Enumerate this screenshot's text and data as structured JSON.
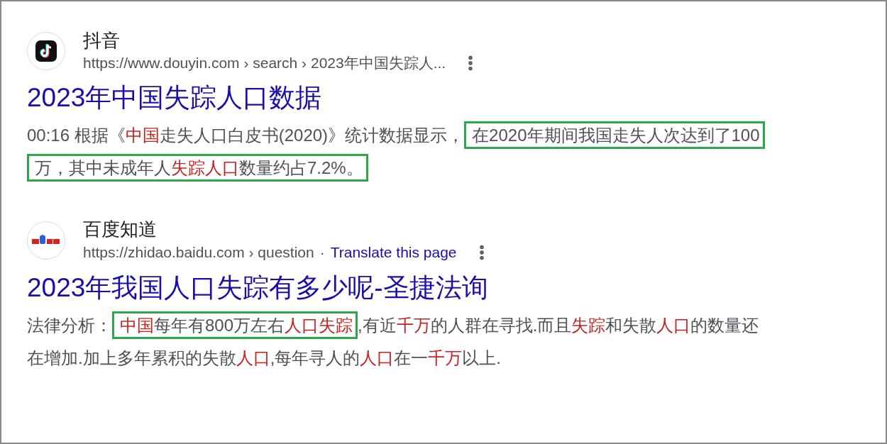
{
  "results": [
    {
      "logo": {
        "kind": "music-note"
      },
      "site": "抖音",
      "url": "https://www.douyin.com › search › 2023年中国失踪人...",
      "title": "2023年中国失踪人口数据",
      "snippet": [
        [
          {
            "boxed": false,
            "segments": [
              {
                "text": "00:16 根据《",
                "red": false
              },
              {
                "text": "中国",
                "red": true
              },
              {
                "text": "走失人口白皮书(2020)》统计数据显示，",
                "red": false
              }
            ]
          },
          {
            "boxed": true,
            "segments": [
              {
                "text": "在2020年期间我国走失人次达到了100",
                "red": false
              }
            ]
          }
        ],
        [
          {
            "boxed": true,
            "segments": [
              {
                "text": "万，其中未成年人",
                "red": false
              },
              {
                "text": "失踪人口",
                "red": true
              },
              {
                "text": "数量约占7.2%。",
                "red": false
              }
            ]
          }
        ]
      ]
    },
    {
      "logo": {
        "kind": "paw-grid"
      },
      "site": "百度知道",
      "url": "https://zhidao.baidu.com › question",
      "separator": "·",
      "translate": "Translate this page",
      "title": "2023年我国人口失踪有多少呢-圣捷法询",
      "snippet": [
        [
          {
            "boxed": false,
            "segments": [
              {
                "text": "法律分析：",
                "red": false
              }
            ]
          },
          {
            "boxed": true,
            "segments": [
              {
                "text": "中国",
                "red": true
              },
              {
                "text": "每年有800万左右",
                "red": false
              },
              {
                "text": "人口失踪",
                "red": true
              }
            ]
          },
          {
            "boxed": false,
            "segments": [
              {
                "text": ",有近",
                "red": false
              },
              {
                "text": "千万",
                "red": true
              },
              {
                "text": "的人群在寻找.而且",
                "red": false
              },
              {
                "text": "失踪",
                "red": true
              },
              {
                "text": "和失散",
                "red": false
              },
              {
                "text": "人口",
                "red": true
              },
              {
                "text": "的数量还",
                "red": false
              }
            ]
          }
        ],
        [
          {
            "boxed": false,
            "segments": [
              {
                "text": "在增加.加上多年累积的失散",
                "red": false
              },
              {
                "text": "人口",
                "red": true
              },
              {
                "text": ",每年寻人的",
                "red": false
              },
              {
                "text": "人口",
                "red": true
              },
              {
                "text": "在一",
                "red": false
              },
              {
                "text": "千万",
                "red": true
              },
              {
                "text": "以上.",
                "red": false
              }
            ]
          }
        ]
      ]
    }
  ]
}
